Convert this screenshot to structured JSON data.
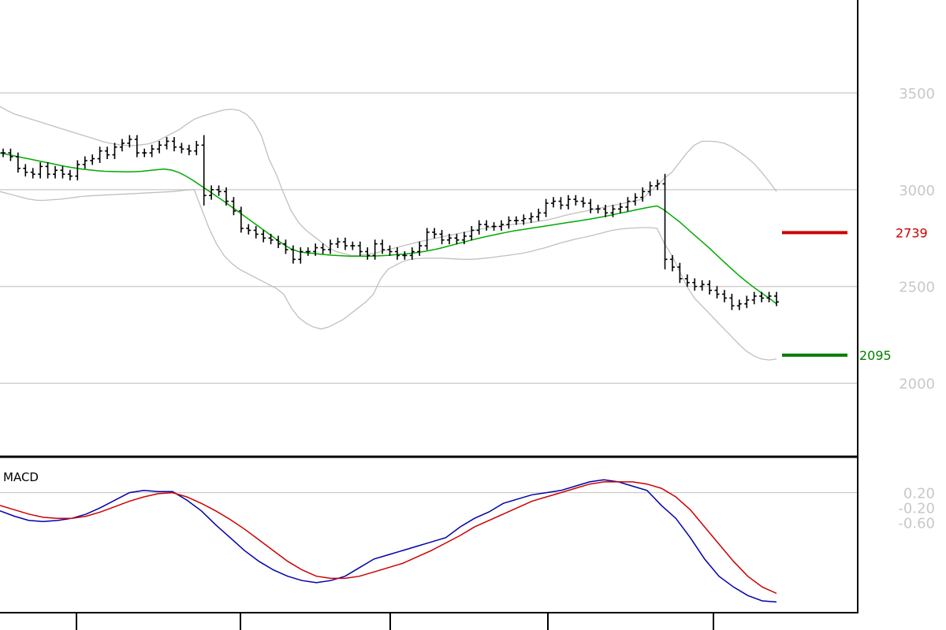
{
  "chart_data": [
    {
      "type": "ohlc",
      "panel": "price",
      "ylim": [
        1620,
        3980
      ],
      "yticks": [
        2000,
        2500,
        3000,
        3500
      ],
      "grid": true,
      "levels": [
        {
          "label": "2739",
          "value": 2778,
          "color": "#cc0000"
        },
        {
          "label": "2095",
          "value": 2145,
          "color": "#008000"
        }
      ],
      "colors": {
        "bars": "#000000",
        "sma": "#00aa00",
        "bands": "#c0c0c0"
      },
      "closes": [
        3190,
        3170,
        3110,
        3090,
        3080,
        3120,
        3080,
        3100,
        3080,
        3070,
        3130,
        3150,
        3160,
        3200,
        3180,
        3220,
        3240,
        3260,
        3190,
        3190,
        3210,
        3230,
        3250,
        3220,
        3210,
        3200,
        3230,
        2970,
        3000,
        2990,
        2940,
        2890,
        2800,
        2790,
        2770,
        2750,
        2740,
        2720,
        2690,
        2640,
        2680,
        2680,
        2700,
        2690,
        2720,
        2730,
        2710,
        2710,
        2680,
        2660,
        2720,
        2690,
        2680,
        2660,
        2660,
        2680,
        2710,
        2780,
        2770,
        2740,
        2750,
        2740,
        2760,
        2790,
        2820,
        2810,
        2810,
        2820,
        2840,
        2840,
        2850,
        2860,
        2880,
        2930,
        2940,
        2920,
        2950,
        2940,
        2930,
        2900,
        2900,
        2880,
        2900,
        2910,
        2940,
        2960,
        2990,
        3020,
        3030,
        2640,
        2600,
        2540,
        2520,
        2500,
        2510,
        2480,
        2460,
        2440,
        2400,
        2410,
        2430,
        2450,
        2440,
        2450,
        2420
      ],
      "sma": [
        3190,
        3182,
        3174,
        3166,
        3158,
        3150,
        3142,
        3134,
        3126,
        3118,
        3112,
        3106,
        3102,
        3098,
        3095,
        3094,
        3093,
        3092,
        3093,
        3095,
        3099,
        3103,
        3107,
        3101,
        3088,
        3068,
        3044,
        3018,
        2992,
        2966,
        2940,
        2912,
        2884,
        2856,
        2828,
        2800,
        2772,
        2744,
        2716,
        2694,
        2680,
        2674,
        2670,
        2666,
        2663,
        2660,
        2658,
        2656,
        2656,
        2656,
        2657,
        2659,
        2661,
        2664,
        2667,
        2671,
        2676,
        2682,
        2689,
        2698,
        2708,
        2718,
        2728,
        2738,
        2748,
        2757,
        2765,
        2773,
        2781,
        2788,
        2794,
        2800,
        2806,
        2812,
        2818,
        2824,
        2830,
        2836,
        2842,
        2848,
        2855,
        2862,
        2870,
        2878,
        2886,
        2894,
        2902,
        2910,
        2916,
        2894,
        2864,
        2834,
        2800,
        2766,
        2732,
        2698,
        2662,
        2626,
        2590,
        2556,
        2524,
        2494,
        2466,
        2440,
        2410
      ],
      "upper_band": [
        3430,
        3408,
        3390,
        3378,
        3366,
        3354,
        3342,
        3330,
        3318,
        3306,
        3294,
        3282,
        3270,
        3258,
        3246,
        3238,
        3232,
        3228,
        3228,
        3232,
        3238,
        3250,
        3270,
        3290,
        3310,
        3338,
        3364,
        3378,
        3390,
        3402,
        3412,
        3416,
        3410,
        3390,
        3350,
        3280,
        3160,
        3080,
        2980,
        2890,
        2830,
        2790,
        2760,
        2730,
        2700,
        2680,
        2670,
        2660,
        2660,
        2665,
        2670,
        2680,
        2690,
        2700,
        2710,
        2720,
        2730,
        2738,
        2746,
        2754,
        2762,
        2770,
        2778,
        2786,
        2794,
        2800,
        2806,
        2812,
        2818,
        2822,
        2826,
        2830,
        2836,
        2842,
        2850,
        2860,
        2870,
        2878,
        2886,
        2894,
        2902,
        2910,
        2918,
        2926,
        2934,
        2942,
        2950,
        2990,
        3020,
        3060,
        3090,
        3140,
        3190,
        3230,
        3250,
        3250,
        3248,
        3240,
        3222,
        3196,
        3168,
        3134,
        3090,
        3042,
        2990
      ],
      "lower_band": [
        2990,
        2980,
        2970,
        2960,
        2950,
        2945,
        2945,
        2948,
        2950,
        2955,
        2960,
        2965,
        2968,
        2970,
        2972,
        2974,
        2976,
        2978,
        2980,
        2982,
        2984,
        2986,
        2988,
        2990,
        2994,
        2998,
        3000,
        2900,
        2800,
        2720,
        2660,
        2620,
        2590,
        2570,
        2550,
        2530,
        2510,
        2490,
        2460,
        2390,
        2340,
        2310,
        2290,
        2280,
        2290,
        2310,
        2330,
        2360,
        2390,
        2420,
        2460,
        2540,
        2590,
        2610,
        2630,
        2640,
        2645,
        2646,
        2646,
        2646,
        2644,
        2642,
        2640,
        2640,
        2642,
        2646,
        2650,
        2656,
        2660,
        2666,
        2672,
        2680,
        2690,
        2700,
        2712,
        2724,
        2734,
        2744,
        2752,
        2760,
        2770,
        2780,
        2790,
        2796,
        2800,
        2802,
        2804,
        2804,
        2800,
        2720,
        2660,
        2580,
        2500,
        2440,
        2400,
        2360,
        2320,
        2280,
        2240,
        2200,
        2165,
        2140,
        2125,
        2120,
        2125
      ],
      "sample": "even"
    },
    {
      "type": "line",
      "panel": "macd",
      "title": "MACD",
      "ylim": [
        -110,
        34
      ],
      "yticks": [
        {
          "label": "0.20",
          "value": 2
        },
        {
          "label": "-0.20",
          "value": -12
        },
        {
          "label": "-0.60",
          "value": -26
        }
      ],
      "grid": true,
      "series": [
        {
          "color": "#0000aa",
          "values": [
            -15,
            -20,
            -24,
            -25,
            -24,
            -22,
            -18,
            -12,
            -5,
            2,
            4,
            3,
            3,
            -5,
            -15,
            -28,
            -40,
            -52,
            -62,
            -70,
            -76,
            -80,
            -82,
            -80,
            -76,
            -68,
            -60,
            -56,
            -52,
            -48,
            -44,
            -40,
            -30,
            -22,
            -16,
            -8,
            -4,
            0,
            2,
            4,
            8,
            12,
            14,
            12,
            8,
            4,
            -10,
            -22,
            -40,
            -60,
            -76,
            -86,
            -94,
            -99,
            -100
          ]
        },
        {
          "color": "#cc0000",
          "values": [
            -10,
            -14,
            -18,
            -21,
            -22,
            -22,
            -20,
            -16,
            -11,
            -6,
            -2,
            1,
            2,
            -2,
            -8,
            -15,
            -23,
            -32,
            -42,
            -52,
            -62,
            -70,
            -76,
            -78,
            -78,
            -76,
            -72,
            -68,
            -64,
            -58,
            -52,
            -45,
            -38,
            -30,
            -24,
            -18,
            -12,
            -6,
            -2,
            2,
            6,
            10,
            12,
            12,
            12,
            10,
            6,
            -2,
            -14,
            -30,
            -46,
            -62,
            -76,
            -86,
            -92
          ]
        }
      ],
      "sample": "even"
    }
  ]
}
